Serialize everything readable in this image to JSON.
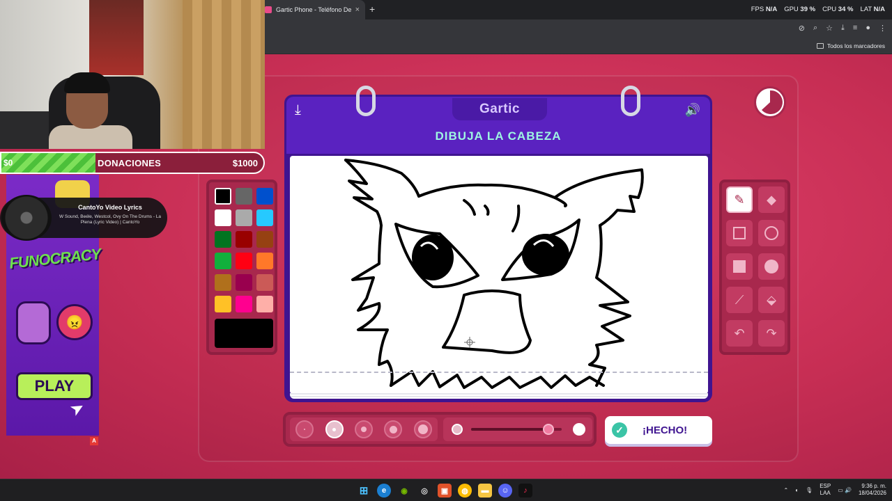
{
  "browser": {
    "tab_title": "Gartic Phone - Teléfono Descon",
    "tab_close": "×",
    "new_tab": "+",
    "stats": [
      {
        "label": "FPS",
        "value": "N/A"
      },
      {
        "label": "GPU",
        "value": "39 %"
      },
      {
        "label": "CPU",
        "value": "34 %"
      },
      {
        "label": "LAT",
        "value": "N/A"
      }
    ],
    "bookmarks_all": "Todos los marcadores"
  },
  "overlay": {
    "donations": {
      "min": "$0",
      "title": "DONACIONES",
      "max": "$1000",
      "progress_fraction": 0.36
    },
    "now_playing": {
      "title": "CantoYo Video Lyrics",
      "subtitle": "W Sound, Beéle, Westcol, Ovy On The Drums - La Plena (Lyric Video) | CantoYo"
    },
    "ad": {
      "brand_a": "FUN",
      "brand_b": "OCRACY",
      "play": "PLAY",
      "badge": "A"
    }
  },
  "game": {
    "logo": "Gartic",
    "task": "DIBUJA LA CABEZA",
    "palette": [
      "#000000",
      "#666666",
      "#0050cd",
      "#ffffff",
      "#aaaaaa",
      "#26c9ff",
      "#017420",
      "#990000",
      "#964112",
      "#11b03c",
      "#ff0013",
      "#ff7829",
      "#b0701c",
      "#99004e",
      "#cb5a57",
      "#ffc126",
      "#ff008f",
      "#feafa8"
    ],
    "selected_color": "#000000",
    "tools": [
      "pencil-icon",
      "eraser-icon",
      "rectangle-outline-icon",
      "ellipse-outline-icon",
      "rectangle-filled-icon",
      "ellipse-filled-icon",
      "line-icon",
      "bucket-fill-icon",
      "undo-icon",
      "redo-icon"
    ],
    "brush_sizes_count": 5,
    "selected_brush_size": 2,
    "opacity_fraction": 0.85,
    "done_label": "¡HECHO!"
  },
  "taskbar": {
    "lang_top": "ESP",
    "lang_bottom": "LAA",
    "time": "9:36 p. m.",
    "date": "18/04/2026"
  }
}
